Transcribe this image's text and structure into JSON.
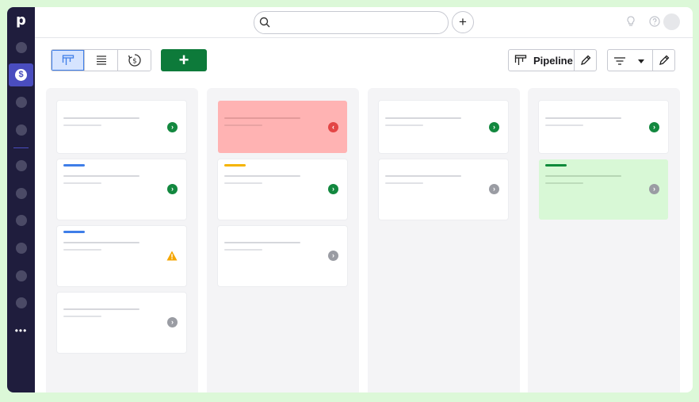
{
  "sidebar": {
    "logo": "p",
    "active_icon": "$",
    "more": "•••",
    "items": [
      "deals-icon",
      "activities-icon",
      "contacts-icon",
      "campaigns-icon",
      "projects-icon",
      "insights-icon",
      "products-icon",
      "mail-icon",
      "marketplace-icon",
      "settings-icon"
    ]
  },
  "topbar": {
    "search_placeholder": "",
    "add_label": "+"
  },
  "toolbar": {
    "add_deal_label": "+",
    "pipeline_label": "Pipeline",
    "views": [
      "pipeline-view-icon",
      "list-view-icon",
      "forecast-view-icon"
    ]
  },
  "colors": {
    "green": "#13883f",
    "red": "#e34545",
    "grey": "#9a9ca3",
    "warning": "#f5a600",
    "blue_accent": "#3f7ee8",
    "yellow_accent": "#f5b400",
    "green_accent": "#0d8a3a",
    "rotten_card": "#ffb3b3",
    "won_card": "#d8f8d6"
  }
}
